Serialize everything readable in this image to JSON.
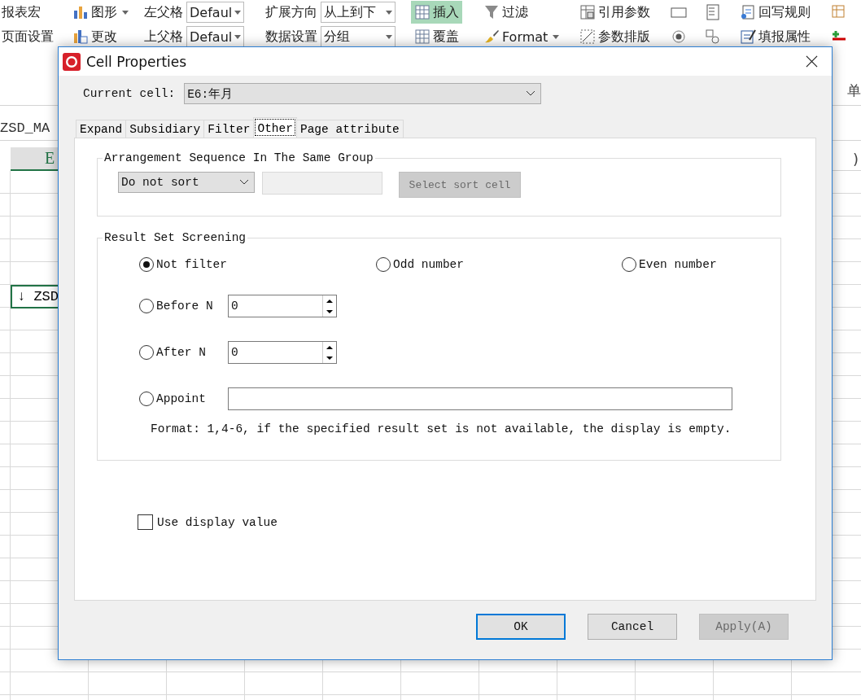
{
  "ribbon": {
    "columns": [
      {
        "items": [
          {
            "kind": "text",
            "label": "报表宏"
          },
          {
            "kind": "text",
            "label": "页面设置"
          }
        ]
      },
      {
        "items": [
          {
            "kind": "tool",
            "label": "图形",
            "caret": true
          },
          {
            "kind": "tool",
            "label": "更改",
            "caret": false
          }
        ]
      },
      {
        "items": [
          {
            "kind": "field",
            "label": "左父格",
            "value": "Defaul"
          },
          {
            "kind": "field",
            "label": "上父格",
            "value": "Defaul"
          }
        ]
      },
      {
        "items": [
          {
            "kind": "field",
            "label": "扩展方向",
            "value": "从上到下"
          },
          {
            "kind": "field",
            "label": "数据设置",
            "value": "分组"
          }
        ]
      },
      {
        "items": [
          {
            "kind": "tool",
            "label": "插入",
            "caret": false,
            "selected": true
          },
          {
            "kind": "tool",
            "label": "覆盖",
            "caret": false,
            "selected": false
          }
        ]
      },
      {
        "items": [
          {
            "kind": "tool",
            "label": "过滤",
            "caret": false
          },
          {
            "kind": "tool",
            "label": "Format",
            "caret": true
          }
        ]
      },
      {
        "items": [
          {
            "kind": "tool",
            "label": "引用参数",
            "caret": false
          },
          {
            "kind": "tool",
            "label": "参数排版",
            "caret": false
          }
        ]
      },
      {
        "items": [
          {
            "kind": "icons"
          },
          {
            "kind": "icons"
          }
        ]
      },
      {
        "items": [
          {
            "kind": "tool",
            "label": "回写规则",
            "caret": false
          },
          {
            "kind": "tool",
            "label": "填报属性",
            "caret": false
          }
        ]
      },
      {
        "items": [
          {
            "kind": "icons"
          },
          {
            "kind": "icons"
          }
        ]
      }
    ],
    "group_label": "单"
  },
  "sheet": {
    "name_box": "ZSD_MA",
    "column_header": "E",
    "column_header_right": ")",
    "active_cell": "↓ ZSD"
  },
  "dialog": {
    "title": "Cell Properties",
    "current_cell": {
      "label": "Current cell:",
      "value": "E6:年月"
    },
    "tabs": [
      {
        "label": "Expand",
        "selected": false
      },
      {
        "label": "Subsidiary",
        "selected": false
      },
      {
        "label": "Filter",
        "selected": false
      },
      {
        "label": "Other",
        "selected": true
      },
      {
        "label": "Page attribute",
        "selected": false
      }
    ],
    "sort_group": {
      "legend": "Arrangement Sequence In The Same Group",
      "sort_select": "Do not sort",
      "select_button": {
        "label": "Select sort cell",
        "disabled": true
      }
    },
    "screening": {
      "legend": "Result Set Screening",
      "options": [
        {
          "kind": "plain",
          "label": "Not filter",
          "selected": true
        },
        {
          "kind": "plain",
          "label": "Odd number",
          "selected": false
        },
        {
          "kind": "plain",
          "label": "Even number",
          "selected": false
        },
        {
          "kind": "spinner",
          "label": "Before N",
          "selected": false,
          "value": "0"
        },
        {
          "kind": "spinner",
          "label": "After N",
          "selected": false,
          "value": "0"
        },
        {
          "kind": "text",
          "label": "Appoint",
          "selected": false
        }
      ],
      "note": "Format: 1,4-6, if the specified result set is not available, the display is empty."
    },
    "use_display_value": {
      "label": "Use display value",
      "checked": false
    },
    "buttons": [
      {
        "label": "OK",
        "default": true,
        "disabled": false
      },
      {
        "label": "Cancel",
        "default": false,
        "disabled": false
      },
      {
        "label": "Apply(A)",
        "default": false,
        "disabled": true
      }
    ]
  }
}
